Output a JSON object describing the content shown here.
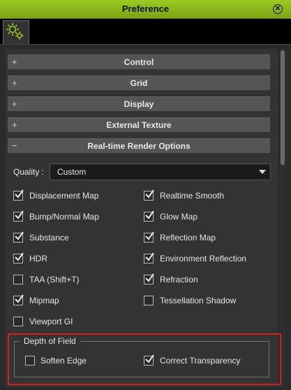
{
  "window": {
    "title": "Preference"
  },
  "tabs": [
    {
      "name": "settings-gears"
    }
  ],
  "sections": [
    {
      "label": "Control",
      "expanded": false
    },
    {
      "label": "Grid",
      "expanded": false
    },
    {
      "label": "Display",
      "expanded": false
    },
    {
      "label": "External Texture",
      "expanded": false
    },
    {
      "label": "Real-time Render Options",
      "expanded": true
    }
  ],
  "symbols": {
    "plus": "+",
    "minus": "−",
    "close": "✕"
  },
  "quality": {
    "label": "Quality :",
    "value": "Custom"
  },
  "options": [
    {
      "label": "Displacement Map",
      "checked": true
    },
    {
      "label": "Realtime Smooth",
      "checked": true
    },
    {
      "label": "Bump/Normal Map",
      "checked": true
    },
    {
      "label": "Glow Map",
      "checked": true
    },
    {
      "label": "Substance",
      "checked": true
    },
    {
      "label": "Reflection Map",
      "checked": true
    },
    {
      "label": "HDR",
      "checked": true
    },
    {
      "label": "Environment Reflection",
      "checked": true
    },
    {
      "label": "TAA (Shift+T)",
      "checked": false
    },
    {
      "label": "Refraction",
      "checked": true
    },
    {
      "label": "Mipmap",
      "checked": true
    },
    {
      "label": "Tessellation Shadow",
      "checked": false
    },
    {
      "label": "Viewport GI",
      "checked": false
    }
  ],
  "depth_of_field": {
    "title": "Depth of Field",
    "options": [
      {
        "label": "Soften Edge",
        "checked": false
      },
      {
        "label": "Correct Transparency",
        "checked": true
      }
    ]
  },
  "colors": {
    "accent": "#8bbb1b",
    "highlight_box": "#d61f1f"
  }
}
